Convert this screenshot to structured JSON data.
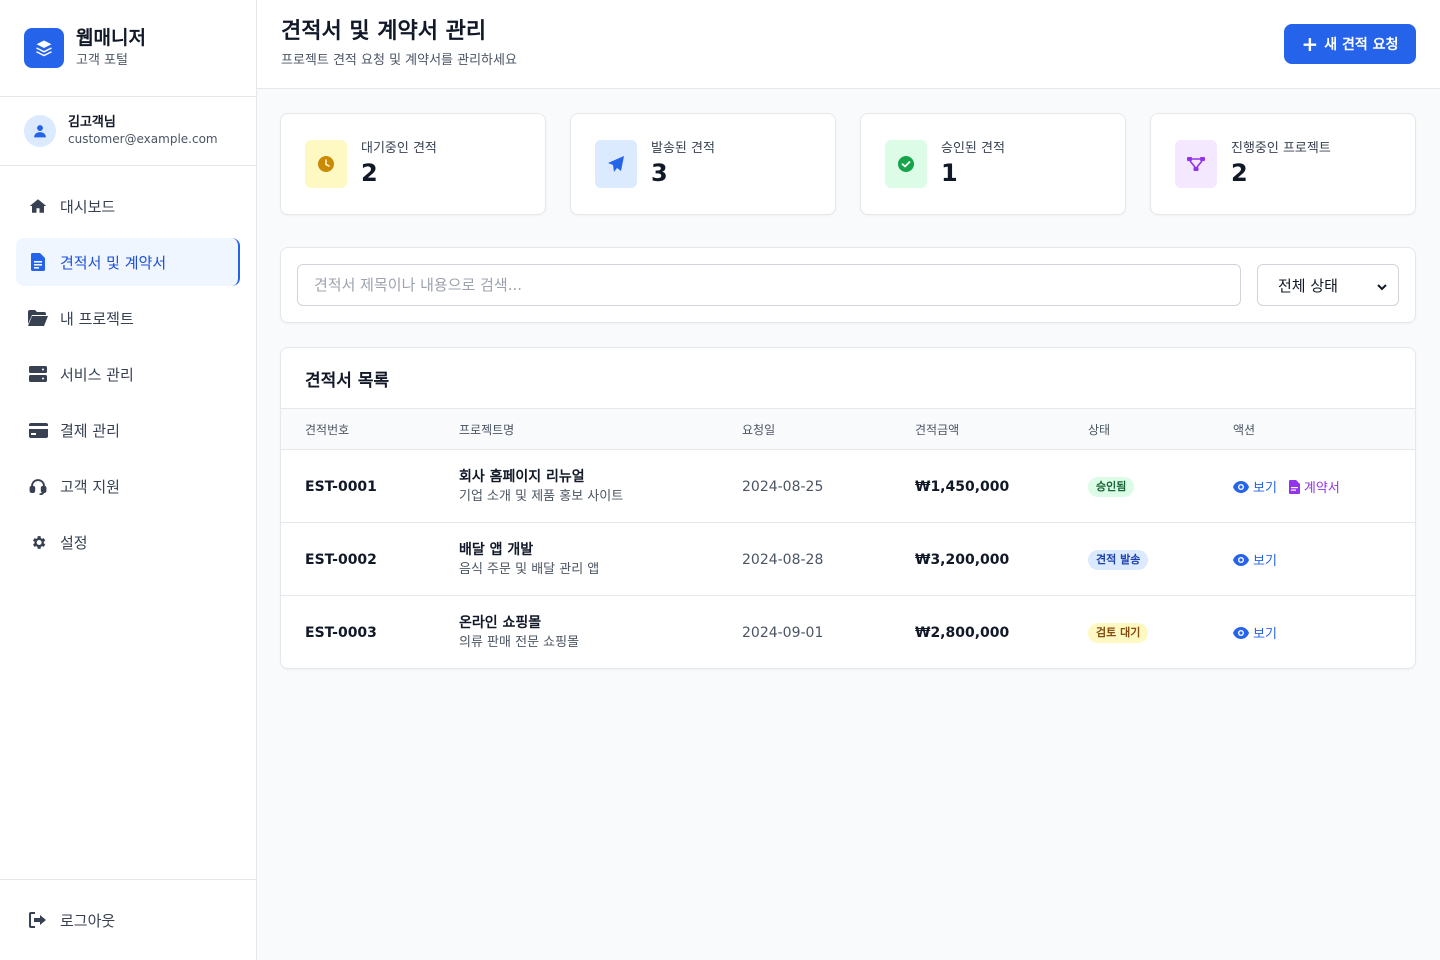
{
  "brand": {
    "title": "웹매니저",
    "subtitle": "고객 포털"
  },
  "user": {
    "name": "김고객님",
    "email": "customer@example.com"
  },
  "nav": {
    "items": [
      {
        "label": "대시보드",
        "icon": "home-icon"
      },
      {
        "label": "견적서 및 계약서",
        "icon": "document-icon",
        "active": true
      },
      {
        "label": "내 프로젝트",
        "icon": "folder-icon"
      },
      {
        "label": "서비스 관리",
        "icon": "server-icon"
      },
      {
        "label": "결제 관리",
        "icon": "credit-card-icon"
      },
      {
        "label": "고객 지원",
        "icon": "headset-icon"
      },
      {
        "label": "설정",
        "icon": "gear-icon"
      }
    ],
    "logout": "로그아웃"
  },
  "header": {
    "title": "견적서 및 계약서 관리",
    "subtitle": "프로젝트 견적 요청 및 계약서를 관리하세요",
    "new_button": "새 견적 요청"
  },
  "stats": [
    {
      "label": "대기중인 견적",
      "value": "2",
      "icon": "clock-icon",
      "bg": "#fef9c3",
      "fg": "#ca8a04"
    },
    {
      "label": "발송된 견적",
      "value": "3",
      "icon": "paper-plane-icon",
      "bg": "#dbeafe",
      "fg": "#2563eb"
    },
    {
      "label": "승인된 견적",
      "value": "1",
      "icon": "check-circle-icon",
      "bg": "#dcfce7",
      "fg": "#16a34a"
    },
    {
      "label": "진행중인 프로젝트",
      "value": "2",
      "icon": "project-diagram-icon",
      "bg": "#f3e8ff",
      "fg": "#9333ea"
    }
  ],
  "filter": {
    "search_placeholder": "견적서 제목이나 내용으로 검색...",
    "status_selected": "전체 상태"
  },
  "table": {
    "title": "견적서 목록",
    "headers": [
      "견적번호",
      "프로젝트명",
      "요청일",
      "견적금액",
      "상태",
      "액션"
    ],
    "view_label": "보기",
    "contract_label": "계약서",
    "rows": [
      {
        "id": "EST-0001",
        "name": "회사 홈페이지 리뉴얼",
        "desc": "기업 소개 및 제품 홍보 사이트",
        "date": "2024-08-25",
        "amount": "₩1,450,000",
        "status": "승인됨",
        "status_bg": "#dcfce7",
        "status_fg": "#166534",
        "has_contract": true
      },
      {
        "id": "EST-0002",
        "name": "배달 앱 개발",
        "desc": "음식 주문 및 배달 관리 앱",
        "date": "2024-08-28",
        "amount": "₩3,200,000",
        "status": "견적 발송",
        "status_bg": "#dbeafe",
        "status_fg": "#1e40af",
        "has_contract": false
      },
      {
        "id": "EST-0003",
        "name": "온라인 쇼핑몰",
        "desc": "의류 판매 전문 쇼핑몰",
        "date": "2024-09-01",
        "amount": "₩2,800,000",
        "status": "검토 대기",
        "status_bg": "#fef9c3",
        "status_fg": "#854d0e",
        "has_contract": false
      }
    ]
  }
}
